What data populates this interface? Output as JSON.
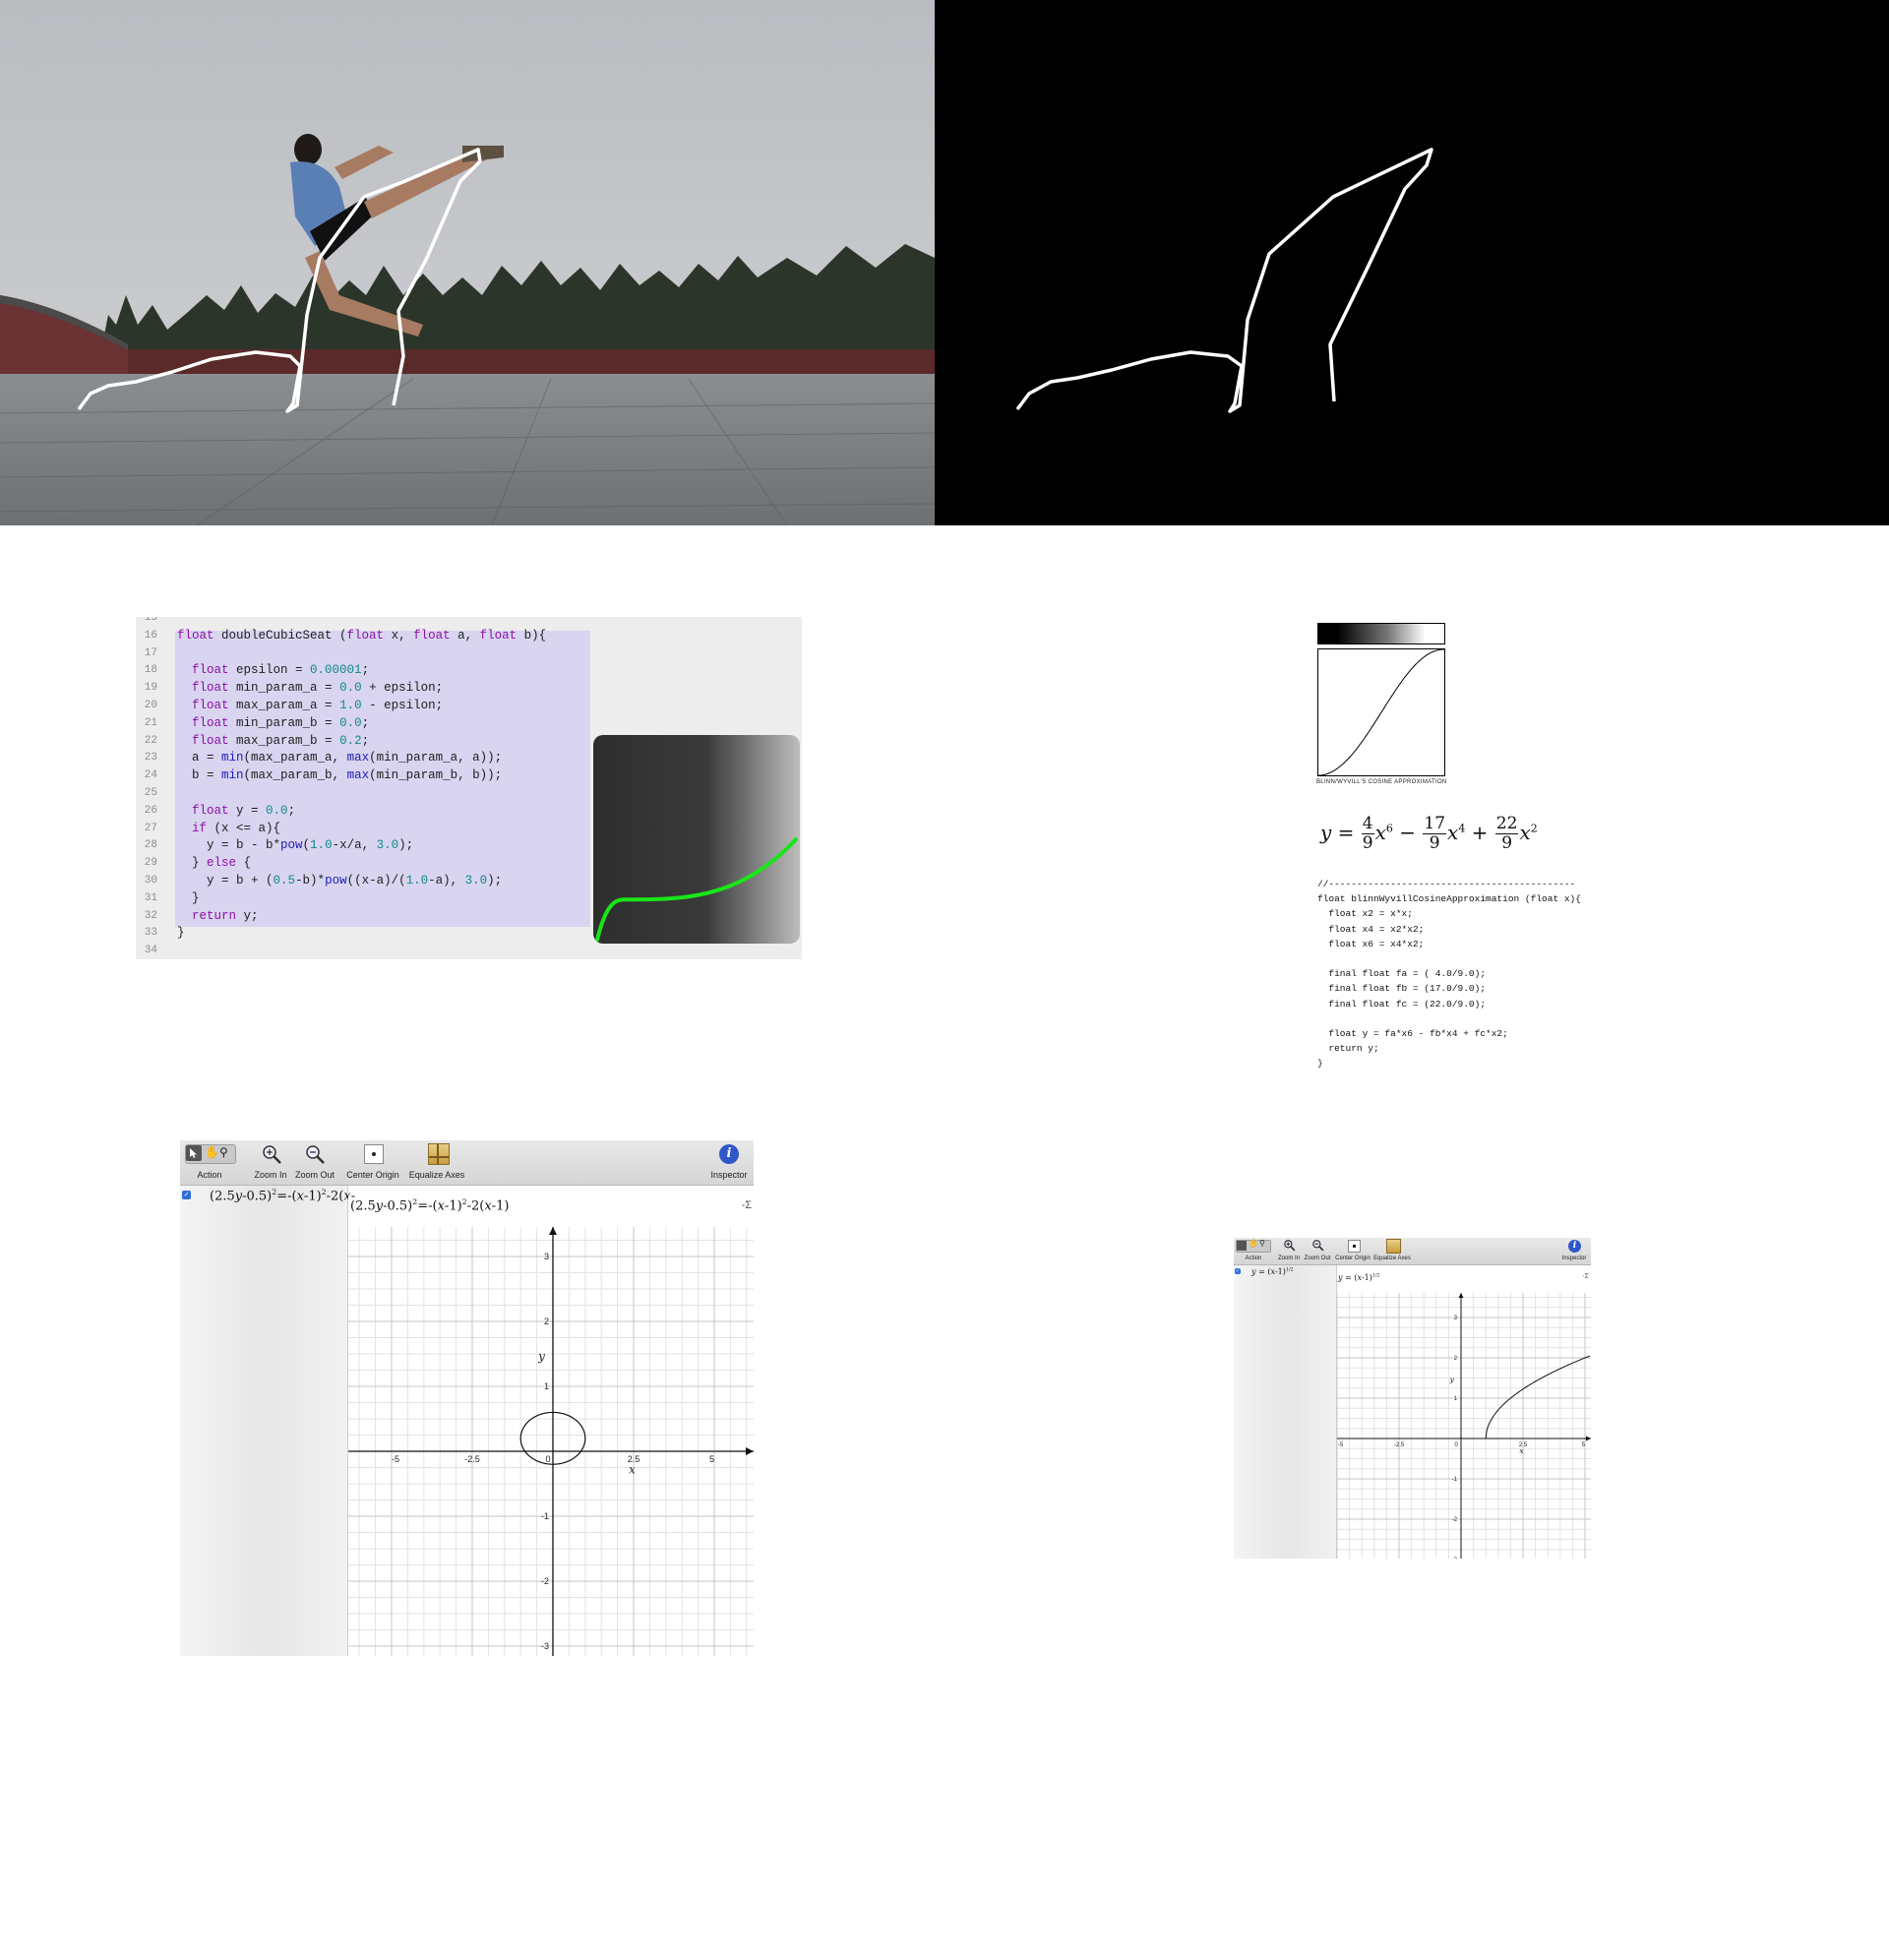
{
  "blinn": {
    "caption": "BLINN/WYVILL'S COSINE APPROXIMATION",
    "code": [
      "//--------------------------------------------",
      "float blinnWyvillCosineApproximation (float x){",
      "  float x2 = x*x;",
      "  float x4 = x2*x2;",
      "  float x6 = x4*x2;",
      "",
      "  final float fa = ( 4.0/9.0);",
      "  final float fb = (17.0/9.0);",
      "  final float fc = (22.0/9.0);",
      "",
      "  float y = fa*x6 - fb*x4 + fc*x2;",
      "  return y;",
      "}"
    ]
  },
  "editor": {
    "line_numbers": [
      "15",
      "16",
      "17",
      "18",
      "19",
      "20",
      "21",
      "22",
      "23",
      "24",
      "25",
      "26",
      "27",
      "28",
      "29",
      "30",
      "31",
      "32",
      "33",
      "34"
    ],
    "code_lines": [
      "",
      "float doubleCubicSeat (float x, float a, float b){",
      "",
      "  float epsilon = 0.00001;",
      "  float min_param_a = 0.0 + epsilon;",
      "  float max_param_a = 1.0 - epsilon;",
      "  float min_param_b = 0.0;",
      "  float max_param_b = 0.2;",
      "  a = min(max_param_a, max(min_param_a, a));",
      "  b = min(max_param_b, max(min_param_b, b));",
      "",
      "  float y = 0.0;",
      "  if (x <= a){",
      "    y = b - b*pow(1.0-x/a, 3.0);",
      "  } else {",
      "    y = b + (0.5-b)*pow((x-a)/(1.0-a), 3.0);",
      "  }",
      "  return y;",
      "}",
      ""
    ],
    "curve_color": "#19e619"
  },
  "grapher_large": {
    "toolbar": {
      "action": "Action",
      "zoom_in": "Zoom In",
      "zoom_out": "Zoom Out",
      "center_origin": "Center Origin",
      "equalize_axes": "Equalize Axes",
      "inspector": "Inspector"
    },
    "sidebar_equation": "(2.5y-0.5)²=-(x-1)²-2(x-",
    "canvas_equation": "(2.5y-0.5)²=-(x-1)²-2(x-1)",
    "sigma_button": "-Σ",
    "axis_x_label": "x",
    "axis_y_label": "y",
    "x_ticks": [
      "-5",
      "-2.5",
      "0",
      "2.5",
      "5"
    ],
    "y_ticks": [
      "3",
      "2",
      "1",
      "-1",
      "-2",
      "-3"
    ],
    "accent_color": "#2f6fd8"
  },
  "grapher_small": {
    "toolbar": {
      "action": "Action",
      "zoom_in": "Zoom In",
      "zoom_out": "Zoom Out",
      "center_origin": "Center Origin",
      "equalize_axes": "Equalize Axes",
      "inspector": "Inspector"
    },
    "sidebar_equation": "y = (x-1)^(1/2)",
    "canvas_equation": "y = (x-1)^(1/2)",
    "sigma_button": "-Σ",
    "axis_x_label": "x",
    "axis_y_label": "y",
    "x_ticks": [
      "-5",
      "-2.5",
      "0",
      "2.5",
      "5"
    ],
    "y_ticks": [
      "3",
      "2",
      "1",
      "-1",
      "-2",
      "-3"
    ]
  }
}
